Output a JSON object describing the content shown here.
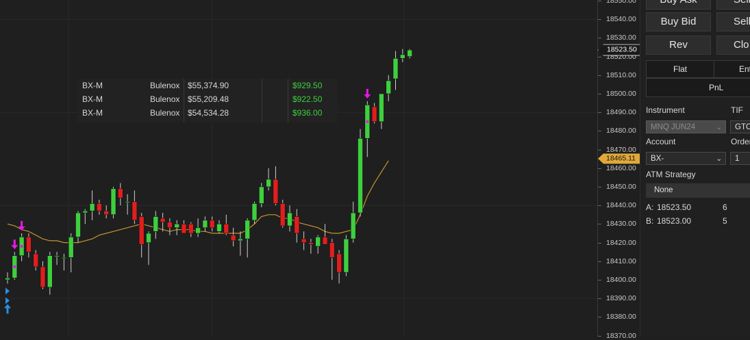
{
  "colors": {
    "bg": "#1f1f1f",
    "grid": "#2a2a2a",
    "up": "#3ecf3e",
    "down": "#e01e1e",
    "ma": "#c8942c",
    "signal_down": "#e619e6",
    "signal_up": "#2a8fe8",
    "pnl_green": "#3ecf3e"
  },
  "price_axis": {
    "ticks": [
      "18550.00",
      "18540.00",
      "18530.00",
      "18520.00",
      "18510.00",
      "18500.00",
      "18490.00",
      "18480.00",
      "18470.00",
      "18460.00",
      "18450.00",
      "18440.00",
      "18430.00",
      "18420.00",
      "18410.00",
      "18400.00",
      "18390.00",
      "18380.00",
      "18370.00"
    ],
    "last_price": "18523.50",
    "ma_price": "18465.11"
  },
  "chart_data": {
    "type": "candlestick",
    "ylim": [
      18370,
      18550
    ],
    "moving_average": [
      18430,
      18429,
      18427,
      18426,
      18424,
      18422,
      18421,
      18421,
      18420,
      18420,
      18420,
      18421,
      18422,
      18424,
      18425,
      18426,
      18427,
      18428,
      18429,
      18430,
      18429,
      18428,
      18427,
      18426,
      18427,
      18427,
      18427,
      18426,
      18426,
      18425,
      18425,
      18425,
      18425,
      18425,
      18427,
      18430,
      18434,
      18435,
      18435,
      18433,
      18433,
      18431,
      18430,
      18429,
      18428,
      18426,
      18425,
      18425,
      18426,
      18427,
      18435,
      18445,
      18452,
      18458,
      18464
    ],
    "candles": [
      {
        "o": 18400,
        "h": 18404,
        "l": 18398,
        "c": 18401
      },
      {
        "o": 18401,
        "h": 18415,
        "l": 18400,
        "c": 18413
      },
      {
        "o": 18413,
        "h": 18425,
        "l": 18410,
        "c": 18423
      },
      {
        "o": 18423,
        "h": 18425,
        "l": 18412,
        "c": 18415
      },
      {
        "o": 18414,
        "h": 18416,
        "l": 18405,
        "c": 18407
      },
      {
        "o": 18407,
        "h": 18410,
        "l": 18395,
        "c": 18396
      },
      {
        "o": 18396,
        "h": 18415,
        "l": 18392,
        "c": 18413
      },
      {
        "o": 18413,
        "h": 18415,
        "l": 18408,
        "c": 18413
      },
      {
        "o": 18412,
        "h": 18414,
        "l": 18405,
        "c": 18412
      },
      {
        "o": 18412,
        "h": 18425,
        "l": 18404,
        "c": 18423
      },
      {
        "o": 18423,
        "h": 18437,
        "l": 18420,
        "c": 18436
      },
      {
        "o": 18436,
        "h": 18438,
        "l": 18430,
        "c": 18437
      },
      {
        "o": 18437,
        "h": 18448,
        "l": 18432,
        "c": 18441
      },
      {
        "o": 18441,
        "h": 18443,
        "l": 18435,
        "c": 18437
      },
      {
        "o": 18437,
        "h": 18440,
        "l": 18433,
        "c": 18435
      },
      {
        "o": 18435,
        "h": 18450,
        "l": 18433,
        "c": 18449
      },
      {
        "o": 18449,
        "h": 18452,
        "l": 18440,
        "c": 18444
      },
      {
        "o": 18442,
        "h": 18446,
        "l": 18435,
        "c": 18442
      },
      {
        "o": 18442,
        "h": 18448,
        "l": 18430,
        "c": 18432
      },
      {
        "o": 18434,
        "h": 18436,
        "l": 18412,
        "c": 18419
      },
      {
        "o": 18420,
        "h": 18426,
        "l": 18408,
        "c": 18425
      },
      {
        "o": 18426,
        "h": 18437,
        "l": 18422,
        "c": 18434
      },
      {
        "o": 18433,
        "h": 18436,
        "l": 18426,
        "c": 18431
      },
      {
        "o": 18431,
        "h": 18433,
        "l": 18424,
        "c": 18428
      },
      {
        "o": 18428,
        "h": 18432,
        "l": 18424,
        "c": 18430
      },
      {
        "o": 18430,
        "h": 18432,
        "l": 18426,
        "c": 18425
      },
      {
        "o": 18430,
        "h": 18431,
        "l": 18423,
        "c": 18425
      },
      {
        "o": 18425,
        "h": 18433,
        "l": 18423,
        "c": 18428
      },
      {
        "o": 18428,
        "h": 18434,
        "l": 18426,
        "c": 18432
      },
      {
        "o": 18432,
        "h": 18434,
        "l": 18426,
        "c": 18428
      },
      {
        "o": 18426,
        "h": 18432,
        "l": 18425,
        "c": 18430
      },
      {
        "o": 18430,
        "h": 18435,
        "l": 18424,
        "c": 18425
      },
      {
        "o": 18424,
        "h": 18428,
        "l": 18418,
        "c": 18421
      },
      {
        "o": 18421,
        "h": 18426,
        "l": 18413,
        "c": 18422
      },
      {
        "o": 18422,
        "h": 18433,
        "l": 18412,
        "c": 18432
      },
      {
        "o": 18432,
        "h": 18442,
        "l": 18430,
        "c": 18441
      },
      {
        "o": 18441,
        "h": 18452,
        "l": 18439,
        "c": 18450
      },
      {
        "o": 18450,
        "h": 18460,
        "l": 18448,
        "c": 18454
      },
      {
        "o": 18454,
        "h": 18461,
        "l": 18440,
        "c": 18441
      },
      {
        "o": 18441,
        "h": 18443,
        "l": 18428,
        "c": 18429
      },
      {
        "o": 18429,
        "h": 18440,
        "l": 18426,
        "c": 18436
      },
      {
        "o": 18434,
        "h": 18438,
        "l": 18420,
        "c": 18425
      },
      {
        "o": 18422,
        "h": 18426,
        "l": 18416,
        "c": 18420
      },
      {
        "o": 18420,
        "h": 18422,
        "l": 18414,
        "c": 18419
      },
      {
        "o": 18418,
        "h": 18424,
        "l": 18414,
        "c": 18423
      },
      {
        "o": 18423,
        "h": 18430,
        "l": 18420,
        "c": 18419
      },
      {
        "o": 18420,
        "h": 18422,
        "l": 18400,
        "c": 18412
      },
      {
        "o": 18414,
        "h": 18416,
        "l": 18398,
        "c": 18404
      },
      {
        "o": 18404,
        "h": 18424,
        "l": 18402,
        "c": 18422
      },
      {
        "o": 18422,
        "h": 18442,
        "l": 18420,
        "c": 18436
      },
      {
        "o": 18436,
        "h": 18481,
        "l": 18434,
        "c": 18476
      },
      {
        "o": 18476,
        "h": 18496,
        "l": 18466,
        "c": 18494
      },
      {
        "o": 18493,
        "h": 18495,
        "l": 18484,
        "c": 18485
      },
      {
        "o": 18485,
        "h": 18500,
        "l": 18481,
        "c": 18500
      },
      {
        "o": 18500,
        "h": 18510,
        "l": 18496,
        "c": 18507
      },
      {
        "o": 18508,
        "h": 18523,
        "l": 18502,
        "c": 18519
      },
      {
        "o": 18519,
        "h": 18524,
        "l": 18517,
        "c": 18521
      },
      {
        "o": 18520,
        "h": 18524,
        "l": 18519,
        "c": 18523.5
      }
    ],
    "signals": [
      {
        "index": 0,
        "kind": "buy"
      },
      {
        "index": 1,
        "kind": "sell"
      },
      {
        "index": 2,
        "kind": "sell"
      },
      {
        "index": 51,
        "kind": "sell"
      }
    ]
  },
  "accounts": [
    {
      "account": "BX-M",
      "firm": "Bulenox",
      "balance": "$55,374.90",
      "pnl": "$929.50"
    },
    {
      "account": "BX-M",
      "firm": "Bulenox",
      "balance": "$55,209.48",
      "pnl": "$922.50"
    },
    {
      "account": "BX-M",
      "firm": "Bulenox",
      "balance": "$54,534.28",
      "pnl": "$936.00"
    }
  ],
  "panel": {
    "buy_ask": "Buy Ask",
    "sell_top": "Sell",
    "buy_bid": "Buy Bid",
    "sell_bid": "Sell",
    "rev": "Rev",
    "close": "Clo",
    "flat": "Flat",
    "entry": "Ent",
    "pnl": "PnL",
    "instrument_label": "Instrument",
    "instrument_value": "MNQ JUN24",
    "tif_label": "TIF",
    "tif_value": "GTC",
    "account_label": "Account",
    "account_value": "BX-",
    "order_label": "Order",
    "order_value": "1",
    "atm_label": "ATM Strategy",
    "atm_value": "None",
    "ask_label": "A:",
    "ask_price": "18523.50",
    "ask_size": "6",
    "bid_label": "B:",
    "bid_price": "18523.00",
    "bid_size": "5"
  }
}
